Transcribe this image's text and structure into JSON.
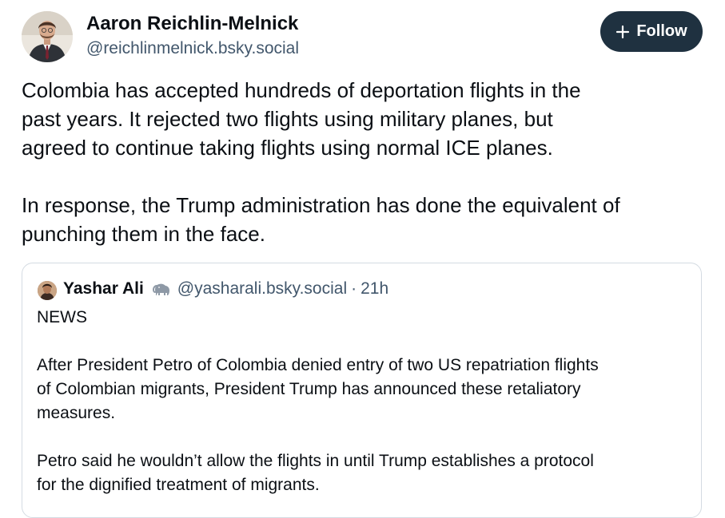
{
  "author": {
    "name": "Aaron Reichlin-Melnick",
    "handle": "@reichlinmelnick.bsky.social"
  },
  "follow_button": {
    "icon": "plus-icon",
    "label": "Follow"
  },
  "post": {
    "paragraph1": [
      "Colombia has accepted hundreds of deportation flights in the",
      "past years. It rejected two flights using military planes, but",
      "agreed to continue taking flights using normal ICE planes."
    ],
    "paragraph2": [
      "In response, the Trump administration has done the equivalent of",
      "punching them in the face."
    ]
  },
  "quote": {
    "name": "Yashar Ali",
    "badge_icon": "elephant-icon",
    "handle": "@yasharali.bsky.social",
    "separator": "·",
    "time": "21h",
    "label": "NEWS",
    "paragraph1": [
      "After President Petro of Colombia denied entry of two US repatriation flights",
      "of Colombian migrants, President Trump has announced these retaliatory",
      "measures."
    ],
    "paragraph2": [
      "Petro said he wouldn’t allow the flights in until Trump establishes a protocol",
      "for the dignified treatment of migrants."
    ]
  },
  "colors": {
    "follow_bg": "#1f3140",
    "secondary_text": "#42576c",
    "card_border": "#d4dbe2"
  }
}
